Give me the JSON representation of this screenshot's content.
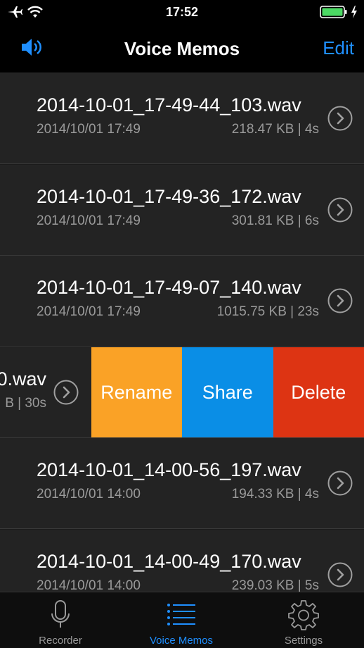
{
  "status": {
    "time": "17:52"
  },
  "nav": {
    "title": "Voice Memos",
    "edit_label": "Edit"
  },
  "memos": [
    {
      "name": "2014-10-01_17-49-44_103.wav",
      "date": "2014/10/01 17:49",
      "meta": "218.47 KB |  4s"
    },
    {
      "name": "2014-10-01_17-49-36_172.wav",
      "date": "2014/10/01 17:49",
      "meta": "301.81 KB |  6s"
    },
    {
      "name": "2014-10-01_17-49-07_140.wav",
      "date": "2014/10/01 17:49",
      "meta": "1015.75 KB | 23s"
    },
    {
      "name": "0.wav",
      "meta": "B | 30s"
    },
    {
      "name": "2014-10-01_14-00-56_197.wav",
      "date": "2014/10/01 14:00",
      "meta": "194.33 KB |  4s"
    },
    {
      "name": "2014-10-01_14-00-49_170.wav",
      "date": "2014/10/01 14:00",
      "meta": "239.03 KB |  5s"
    }
  ],
  "swipe_actions": {
    "rename": "Rename",
    "share": "Share",
    "delete": "Delete"
  },
  "tabs": [
    {
      "label": "Recorder",
      "icon": "microphone-icon",
      "active": false
    },
    {
      "label": "Voice Memos",
      "icon": "list-icon",
      "active": true
    },
    {
      "label": "Settings",
      "icon": "gear-icon",
      "active": false
    }
  ],
  "colors": {
    "accent": "#1f8fff",
    "rename": "#faa226",
    "share": "#0a8ee6",
    "delete": "#dd3413",
    "battery": "#4cd964"
  }
}
